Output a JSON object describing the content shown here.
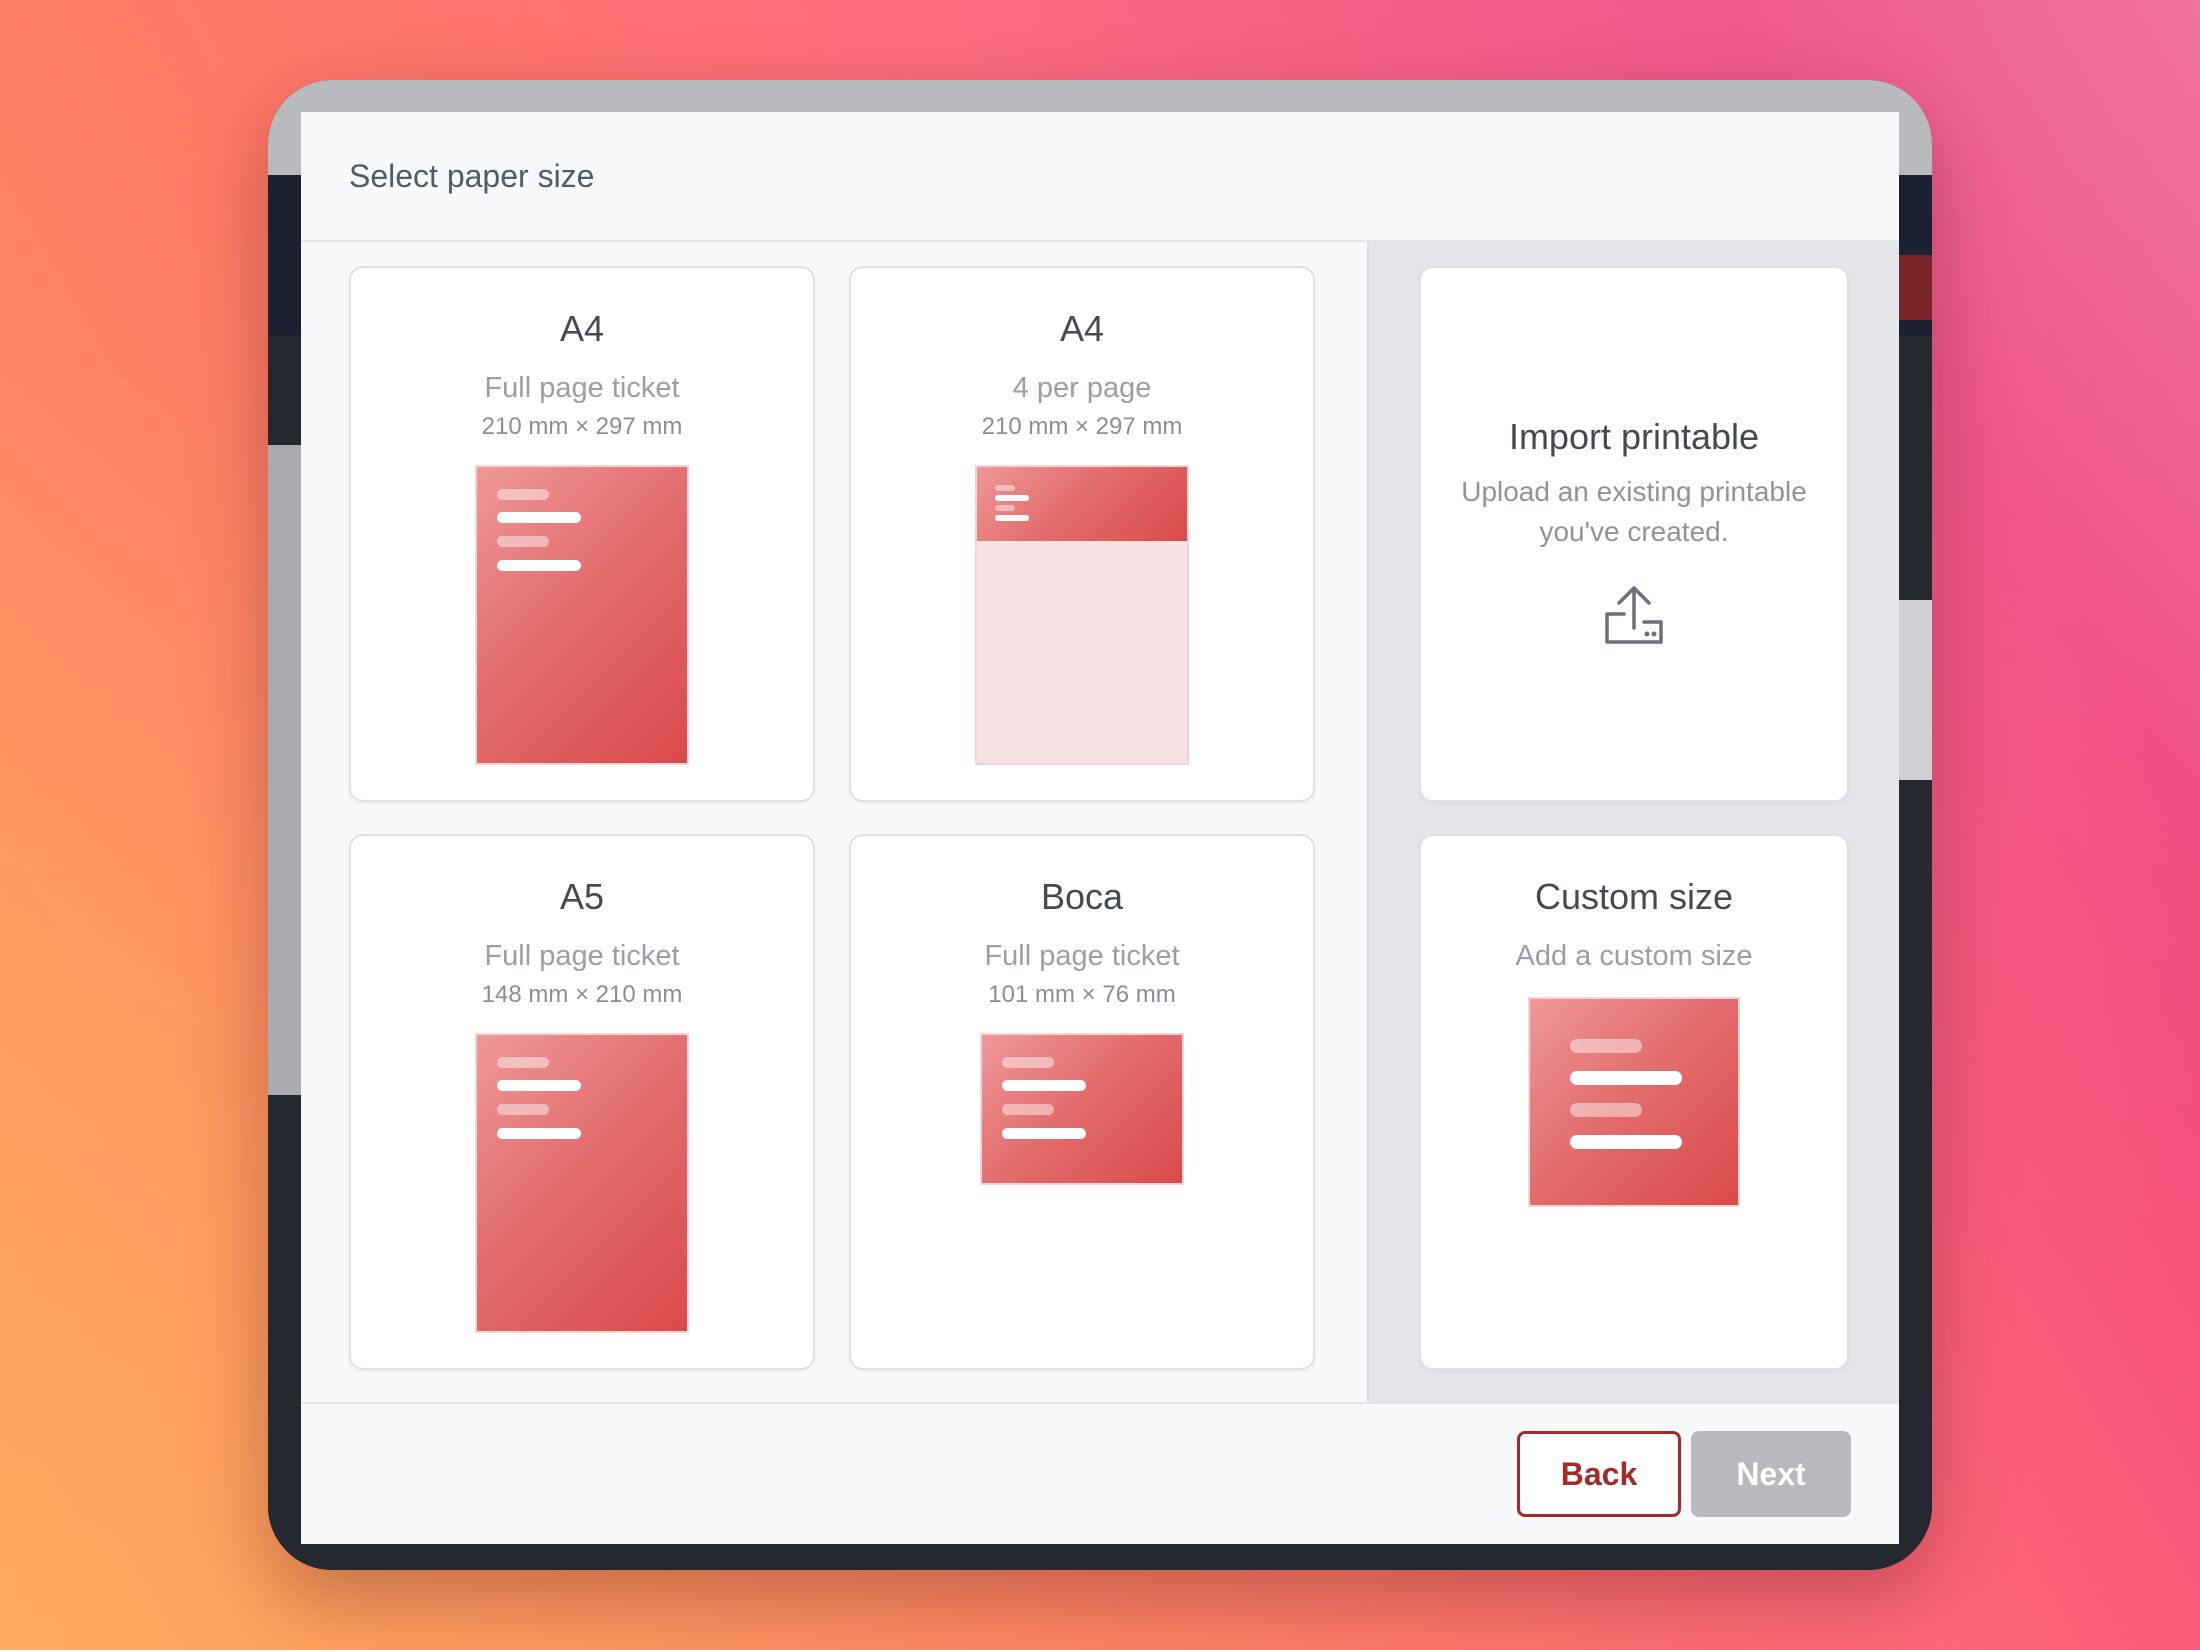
{
  "modal": {
    "title": "Select paper size"
  },
  "cards": [
    {
      "title": "A4",
      "subtitle": "Full page ticket",
      "dimensions": "210 mm × 297 mm"
    },
    {
      "title": "A4",
      "subtitle": "4 per page",
      "dimensions": "210 mm × 297 mm"
    },
    {
      "title": "A5",
      "subtitle": "Full page ticket",
      "dimensions": "148 mm × 210 mm"
    },
    {
      "title": "Boca",
      "subtitle": "Full page ticket",
      "dimensions": "101 mm × 76 mm"
    }
  ],
  "import_card": {
    "title": "Import printable",
    "description": "Upload an existing printable you've created.",
    "icon": "upload-icon"
  },
  "custom_card": {
    "title": "Custom size",
    "subtitle": "Add a custom size"
  },
  "footer": {
    "back_label": "Back",
    "next_label": "Next"
  },
  "colors": {
    "accent": "#a52a2a",
    "paper_gradient_start": "#ef9898",
    "paper_gradient_end": "#da4a4a",
    "disabled_button": "#b8b9bc"
  }
}
